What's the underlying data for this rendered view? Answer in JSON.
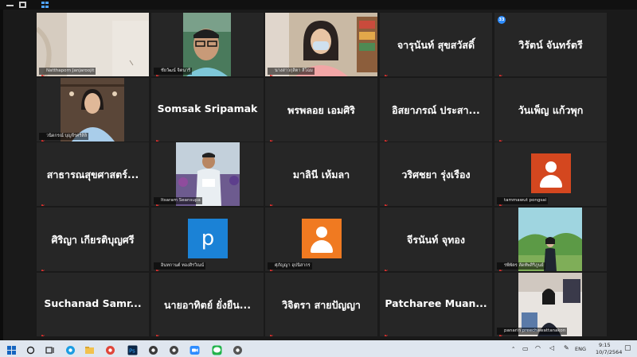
{
  "meeting": {
    "participant_count_badge": "33"
  },
  "tiles": [
    {
      "row": 0,
      "col": 0,
      "type": "photo",
      "photo": "room",
      "label": "Natthaporn Janjaroojit"
    },
    {
      "row": 0,
      "col": 1,
      "type": "photo",
      "photo": "man-glasses",
      "label": "ชัยวัฒน์ จิตนารี"
    },
    {
      "row": 0,
      "col": 2,
      "type": "photo",
      "photo": "woman-mask",
      "label": "นางสาวกุสิตา ลีโฉม"
    },
    {
      "row": 0,
      "col": 3,
      "type": "name",
      "name": "จารุนันท์ สุขสวัสดิ์"
    },
    {
      "row": 0,
      "col": 4,
      "type": "name",
      "name": "วิรัตน์ จันทร์ตรี",
      "badge": true
    },
    {
      "row": 1,
      "col": 0,
      "type": "photo",
      "photo": "woman-blue",
      "label": "วนิดกรณ์ บุญจีรศรีสิลิ"
    },
    {
      "row": 1,
      "col": 1,
      "type": "name",
      "name": "Somsak Sripamak"
    },
    {
      "row": 1,
      "col": 2,
      "type": "name",
      "name": "พรพลอย เอมศิริ"
    },
    {
      "row": 1,
      "col": 3,
      "type": "name",
      "name": "อิสยาภรณ์ ประสา..."
    },
    {
      "row": 1,
      "col": 4,
      "type": "name",
      "name": "วันเพ็ญ แก้วพุก"
    },
    {
      "row": 2,
      "col": 0,
      "type": "name",
      "name": "สาธารณสุขศาสตร์..."
    },
    {
      "row": 2,
      "col": 1,
      "type": "photo",
      "photo": "runner",
      "label": "Itsaram Seansupa"
    },
    {
      "row": 2,
      "col": 2,
      "type": "name",
      "name": "มาลินี เห้มลา"
    },
    {
      "row": 2,
      "col": 3,
      "type": "name",
      "name": "วริศชยา รุ่งเรือง"
    },
    {
      "row": 2,
      "col": 4,
      "type": "avatar",
      "color": "#d4471f",
      "label": "tammawut pongsai"
    },
    {
      "row": 3,
      "col": 0,
      "type": "name",
      "name": "ศิริญา เกียรติบุญศรี"
    },
    {
      "row": 3,
      "col": 1,
      "type": "letter",
      "letter": "p",
      "label": "อินทกานต์ ทองสิรวิณน์"
    },
    {
      "row": 3,
      "col": 2,
      "type": "avatar",
      "color": "#f07a21",
      "label": "ศุภัญญา อุปนิสากร"
    },
    {
      "row": 3,
      "col": 3,
      "type": "name",
      "name": "จีรนันท์ จุทอง"
    },
    {
      "row": 3,
      "col": 4,
      "type": "photo",
      "photo": "garden",
      "label": "รพีพัตร ลัดทัพสิริภูนย์"
    },
    {
      "row": 4,
      "col": 0,
      "type": "name",
      "name": "Suchanad  Samr..."
    },
    {
      "row": 4,
      "col": 1,
      "type": "name",
      "name": "นายอาทิตย์ ยั่งยืน..."
    },
    {
      "row": 4,
      "col": 2,
      "type": "name",
      "name": "วิจิตรา สายปัญญา"
    },
    {
      "row": 4,
      "col": 3,
      "type": "name",
      "name": "Patcharee  Muan..."
    },
    {
      "row": 4,
      "col": 4,
      "type": "photo",
      "photo": "office",
      "label": "panarin preechawattanakon"
    }
  ],
  "taskbar": {
    "icons": [
      "windows-icon",
      "search-icon",
      "task-view-icon",
      "edge-icon",
      "file-explorer-icon",
      "chrome-icon",
      "photoshop-icon",
      "obs-icon",
      "camera-icon",
      "zoom-icon",
      "line-icon",
      "paint-icon"
    ],
    "tray": {
      "lang": "ENG",
      "time": "9:15",
      "date": "10/7/2564"
    }
  }
}
